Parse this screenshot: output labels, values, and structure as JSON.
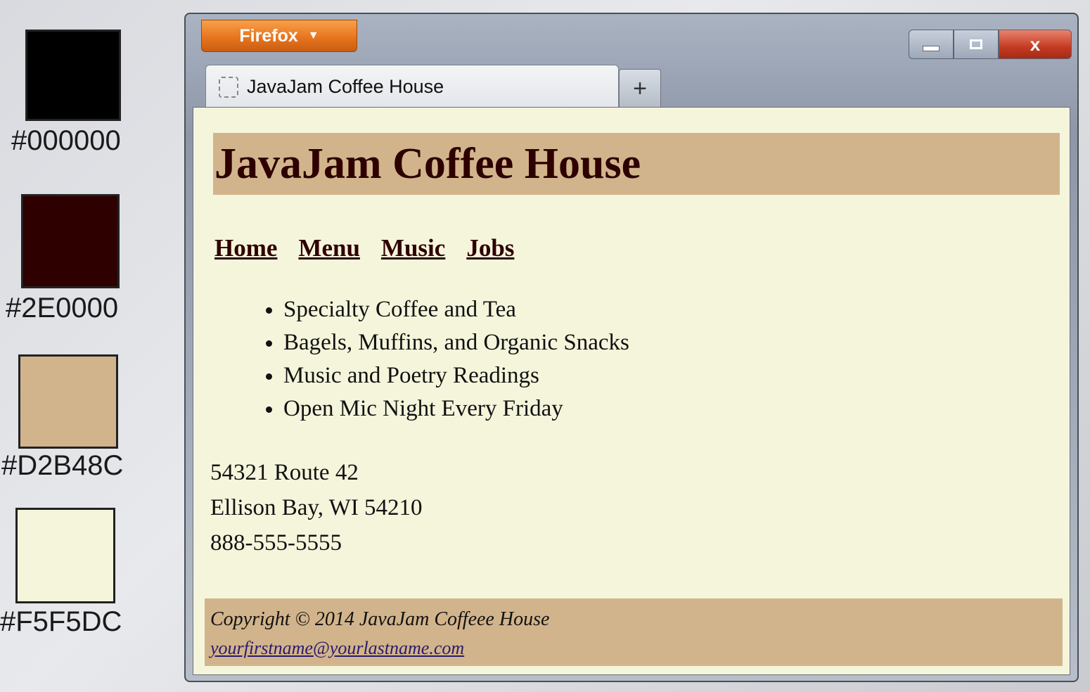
{
  "swatches": [
    {
      "label": "#000000",
      "color": "#000000"
    },
    {
      "label": "#2E0000",
      "color": "#2E0000"
    },
    {
      "label": "#D2B48C",
      "color": "#D2B48C"
    },
    {
      "label": "#F5F5DC",
      "color": "#F5F5DC"
    }
  ],
  "browser": {
    "app_button": "Firefox",
    "tab_title": "JavaJam Coffee House",
    "new_tab": "+",
    "close": "x"
  },
  "page": {
    "title": "JavaJam Coffee House",
    "nav": [
      "Home",
      "Menu",
      "Music",
      "Jobs"
    ],
    "features": [
      "Specialty Coffee and Tea",
      "Bagels, Muffins, and Organic Snacks",
      "Music and Poetry Readings",
      "Open Mic Night Every Friday"
    ],
    "address": [
      "54321 Route 42",
      "Ellison Bay, WI 54210",
      "888-555-5555"
    ],
    "footer": {
      "copyright": "Copyright © 2014 JavaJam Coffeee House",
      "email": "yourfirstname@yourlastname.com"
    }
  }
}
